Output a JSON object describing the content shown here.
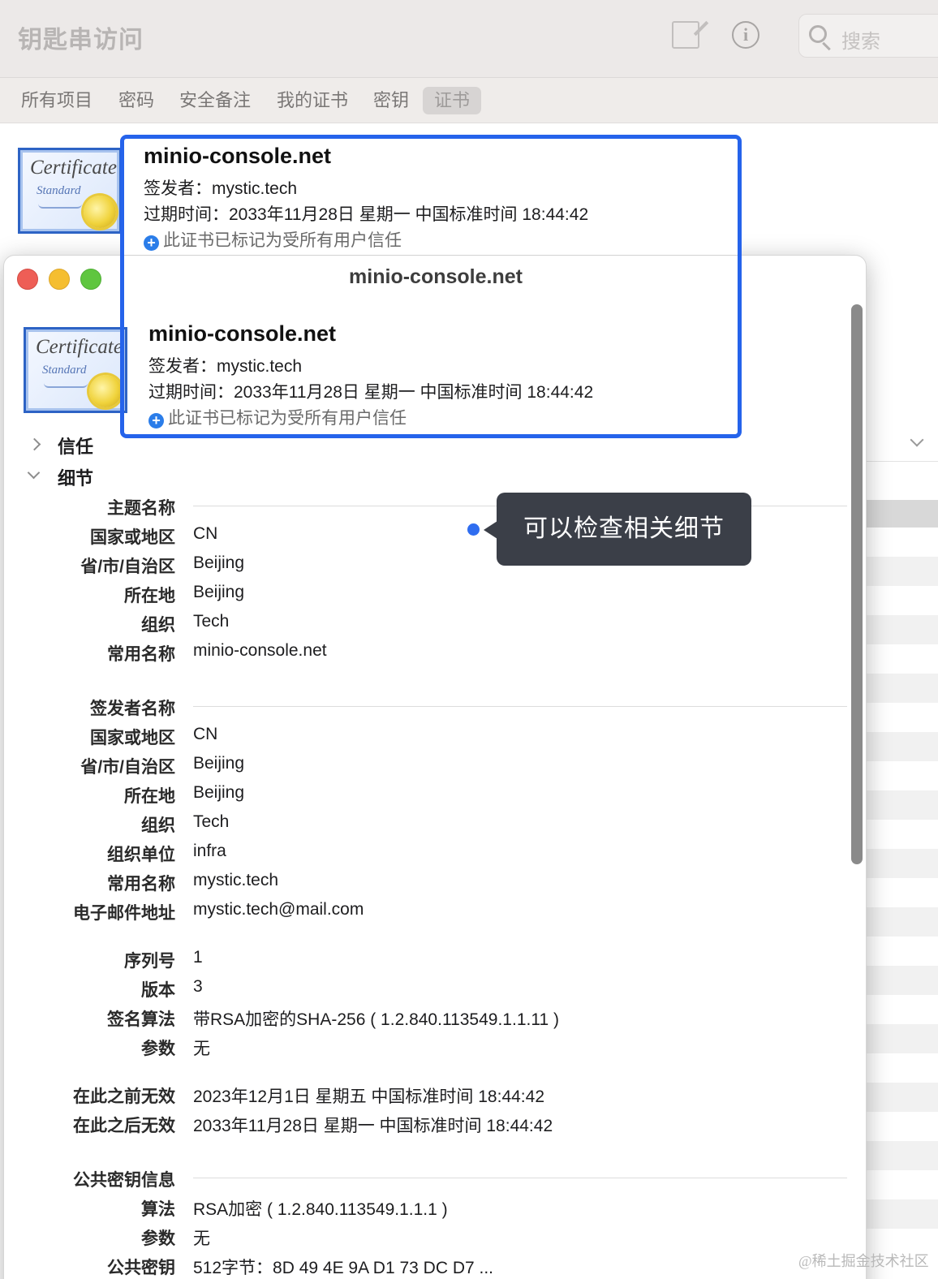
{
  "app": {
    "title": "钥匙串访问",
    "search_placeholder": "搜索",
    "tabs": [
      {
        "label": "所有项目",
        "active": false
      },
      {
        "label": "密码",
        "active": false
      },
      {
        "label": "安全备注",
        "active": false
      },
      {
        "label": "我的证书",
        "active": false
      },
      {
        "label": "密钥",
        "active": false
      },
      {
        "label": "证书",
        "active": true
      }
    ]
  },
  "certificate": {
    "cert_icon_word": "Certificate",
    "cert_icon_sub": "Standard",
    "name": "minio-console.net",
    "issuer_line": "签发者：mystic.tech",
    "expiry_line": "过期时间：2033年11月28日 星期一 中国标准时间 18:44:42",
    "trust_line": "此证书已标记为受所有用户信任"
  },
  "window": {
    "title": "minio-console.net"
  },
  "sections": {
    "trust": "信任",
    "details": "细节"
  },
  "tooltip": {
    "text": "可以检查相关细节"
  },
  "details": {
    "subject": {
      "heading": "主题名称",
      "rows": [
        {
          "label": "国家或地区",
          "value": "CN"
        },
        {
          "label": "省/市/自治区",
          "value": "Beijing"
        },
        {
          "label": "所在地",
          "value": "Beijing"
        },
        {
          "label": "组织",
          "value": "Tech"
        },
        {
          "label": "常用名称",
          "value": "minio-console.net"
        }
      ]
    },
    "issuer": {
      "heading": "签发者名称",
      "rows": [
        {
          "label": "国家或地区",
          "value": "CN"
        },
        {
          "label": "省/市/自治区",
          "value": "Beijing"
        },
        {
          "label": "所在地",
          "value": "Beijing"
        },
        {
          "label": "组织",
          "value": "Tech"
        },
        {
          "label": "组织单位",
          "value": "infra"
        },
        {
          "label": "常用名称",
          "value": "mystic.tech"
        },
        {
          "label": "电子邮件地址",
          "value": "mystic.tech@mail.com"
        }
      ]
    },
    "misc": [
      {
        "label": "序列号",
        "value": "1"
      },
      {
        "label": "版本",
        "value": "3"
      },
      {
        "label": "签名算法",
        "value": "带RSA加密的SHA-256 ( 1.2.840.113549.1.1.11 )"
      },
      {
        "label": "参数",
        "value": "无"
      }
    ],
    "validity": [
      {
        "label": "在此之前无效",
        "value": "2023年12月1日 星期五 中国标准时间 18:44:42"
      },
      {
        "label": "在此之后无效",
        "value": "2033年11月28日 星期一 中国标准时间 18:44:42"
      }
    ],
    "public_key": {
      "heading": "公共密钥信息",
      "rows": [
        {
          "label": "算法",
          "value": "RSA加密 ( 1.2.840.113549.1.1.1 )"
        },
        {
          "label": "参数",
          "value": "无"
        },
        {
          "label": "公共密钥",
          "value": "512字节：8D 49 4E 9A D1 73 DC D7 ..."
        }
      ]
    }
  },
  "watermark": "@稀土掘金技术社区"
}
